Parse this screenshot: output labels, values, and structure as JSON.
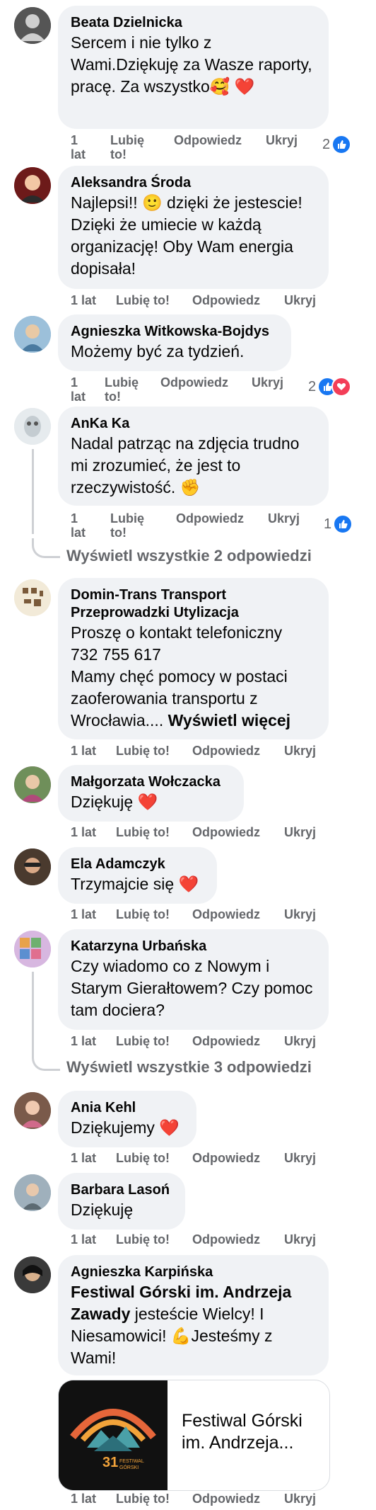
{
  "actions": {
    "time": "1 lat",
    "time_num": "1",
    "time_unit": "lat",
    "like": "Lubię to!",
    "like_part1": "Lubię",
    "like_part2": "to!",
    "reply": "Odpowiedz",
    "hide": "Ukryj"
  },
  "comments": [
    {
      "author": "Beata Dzielnicka",
      "text": "Sercem i nie tylko z Wami.Dziękuję za Wasze raporty, pracę. Za wszystko🥰 ❤️",
      "reactions": "2"
    },
    {
      "author": "Aleksandra Środa",
      "text": "Najlepsi!! 🙂 dzięki że jestescie! Dzięki że umiecie w każdą organizację! Oby Wam energia dopisała!"
    },
    {
      "author": "Agnieszka Witkowska-Bojdys",
      "text": "Możemy być za tydzień.",
      "reactions": "2"
    },
    {
      "author": "AnKa Ka",
      "text": "Nadal patrząc na zdjęcia trudno mi zrozumieć, że jest to rzeczywistość. ✊",
      "reactions": "1",
      "view_replies": "Wyświetl wszystkie 2 odpowiedzi"
    },
    {
      "author_line1": "Domin-Trans Transport",
      "author_line2": "Przeprowadzki Utylizacja",
      "text_line1": "Proszę o kontakt telefoniczny",
      "text_line2": "732 755 617",
      "text_line3": "Mamy chęć pomocy w postaci zaoferowania transportu z Wrocławia....",
      "see_more": "Wyświetl więcej"
    },
    {
      "author": "Małgorzata Wołczacka",
      "text": "Dziękuję ❤️"
    },
    {
      "author": "Ela Adamczyk",
      "text": "Trzymajcie się ❤️"
    },
    {
      "author": "Katarzyna Urbańska",
      "text": "Czy wiadomo co z Nowym i Starym Gierałtowem? Czy pomoc tam dociera?",
      "view_replies": "Wyświetl wszystkie 3 odpowiedzi"
    },
    {
      "author": "Ania Kehl",
      "text": "Dziękujemy ❤️"
    },
    {
      "author": "Barbara Lasoń",
      "text": "Dziękuję"
    },
    {
      "author": "Agnieszka Karpińska",
      "text_bold": "Festiwal Górski im. Andrzeja Zawady",
      "text_rest": "jesteście Wielcy! I Niesamowici! 💪Jesteśmy z Wami!",
      "card_title": "Festiwal Górski im. Andrzeja...",
      "card_logo_text": "31 FESTIWAL GÓRSKI"
    }
  ],
  "colors": {
    "like": "#1877f2",
    "love": "#f33e58",
    "bubble": "#f0f2f5",
    "meta": "#65676b"
  }
}
